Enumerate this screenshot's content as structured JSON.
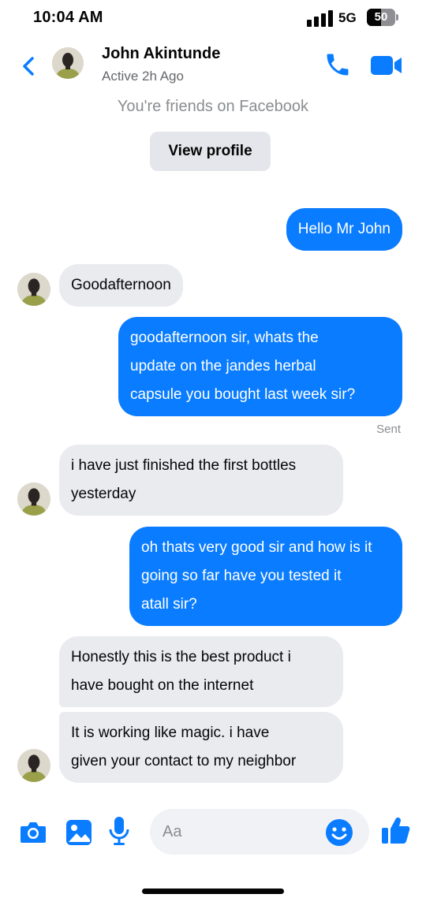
{
  "status_bar": {
    "time": "10:04 AM",
    "network": "5G",
    "battery": "50"
  },
  "header": {
    "contact_name": "John Akintunde",
    "status": "Active 2h Ago",
    "back_icon": "chevron-left-icon",
    "call_icon": "phone-icon",
    "video_icon": "video-camera-icon"
  },
  "intro": {
    "friends_note": "You're friends on Facebook",
    "view_profile_label": "View profile"
  },
  "messages": [
    {
      "direction": "outgoing",
      "lines": [
        "Hello Mr John"
      ]
    },
    {
      "direction": "incoming",
      "lines": [
        "Goodafternoon"
      ]
    },
    {
      "direction": "outgoing",
      "lines": [
        "goodafternoon sir, whats the",
        "update on the jandes herbal",
        "capsule you bought last week sir?"
      ]
    },
    {
      "direction": "incoming",
      "lines": [
        "i have just finished the first bottles",
        "yesterday"
      ]
    },
    {
      "direction": "outgoing",
      "lines": [
        "oh thats very good sir and how is it",
        "going so far have you tested it",
        "atall sir?"
      ]
    },
    {
      "direction": "incoming",
      "lines": [
        "Honestly this is the best product i",
        "have bought on the internet"
      ]
    },
    {
      "direction": "incoming",
      "lines": [
        "It is working like magic. i have",
        "given your contact to my neighbor"
      ]
    }
  ],
  "sent_label": "Sent",
  "composer": {
    "placeholder": "Aa",
    "icons": [
      "camera-icon",
      "gallery-icon",
      "microphone-icon",
      "emoji-icon",
      "thumbs-up-icon"
    ]
  },
  "colors": {
    "accent": "#0a7cff",
    "incoming_bubble": "#e9ebef",
    "muted_text": "#65676b"
  }
}
